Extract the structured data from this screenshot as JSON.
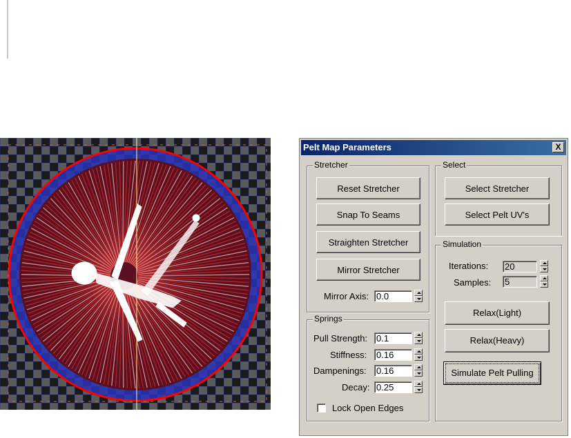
{
  "dialog": {
    "title": "Pelt Map Parameters",
    "close_label": "X",
    "stretcher": {
      "legend": "Stretcher",
      "reset_label": "Reset Stretcher",
      "snap_label": "Snap To Seams",
      "straighten_label": "Straighten Stretcher",
      "mirror_label": "Mirror Stretcher",
      "mirror_axis_label": "Mirror Axis:",
      "mirror_axis_value": "0.0"
    },
    "select": {
      "legend": "Select",
      "select_stretcher_label": "Select Stretcher",
      "select_pelt_label": "Select Pelt UV's"
    },
    "simulation": {
      "legend": "Simulation",
      "iterations_label": "Iterations:",
      "iterations_value": "20",
      "samples_label": "Samples:",
      "samples_value": "5",
      "relax_light_label": "Relax(Light)",
      "relax_heavy_label": "Relax(Heavy)",
      "simulate_label": "Simulate Pelt Pulling"
    },
    "springs": {
      "legend": "Springs",
      "pull_label": "Pull Strength:",
      "pull_value": "0.1",
      "stiffness_label": "Stiffness:",
      "stiffness_value": "0.16",
      "dampenings_label": "Dampenings:",
      "dampenings_value": "0.16",
      "decay_label": "Decay:",
      "decay_value": "0.25",
      "lock_label": "Lock Open Edges"
    }
  },
  "colors": {
    "checker_dark": "#1a1a1a",
    "checker_light": "#5a5a5a",
    "circle_red": "#ff0000",
    "ring_blue": "#2222cc",
    "mesh_red": "#cc2a2a",
    "titlebar": "#0a246a"
  }
}
